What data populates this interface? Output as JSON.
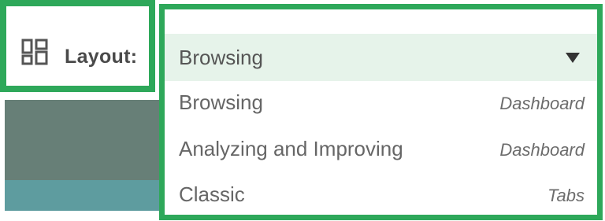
{
  "layout_selector": {
    "label": "Layout:",
    "icon": "layout-grid-icon",
    "selected_value": "Browsing",
    "options": [
      {
        "name": "Browsing",
        "hint": "Dashboard"
      },
      {
        "name": "Analyzing and Improving",
        "hint": "Dashboard"
      },
      {
        "name": "Classic",
        "hint": "Tabs"
      }
    ]
  },
  "colors": {
    "highlight_border": "#2ea85a",
    "selected_row_bg": "#e6f3ea",
    "background_dark": "#677f77",
    "background_teal": "#5e9c9f"
  }
}
